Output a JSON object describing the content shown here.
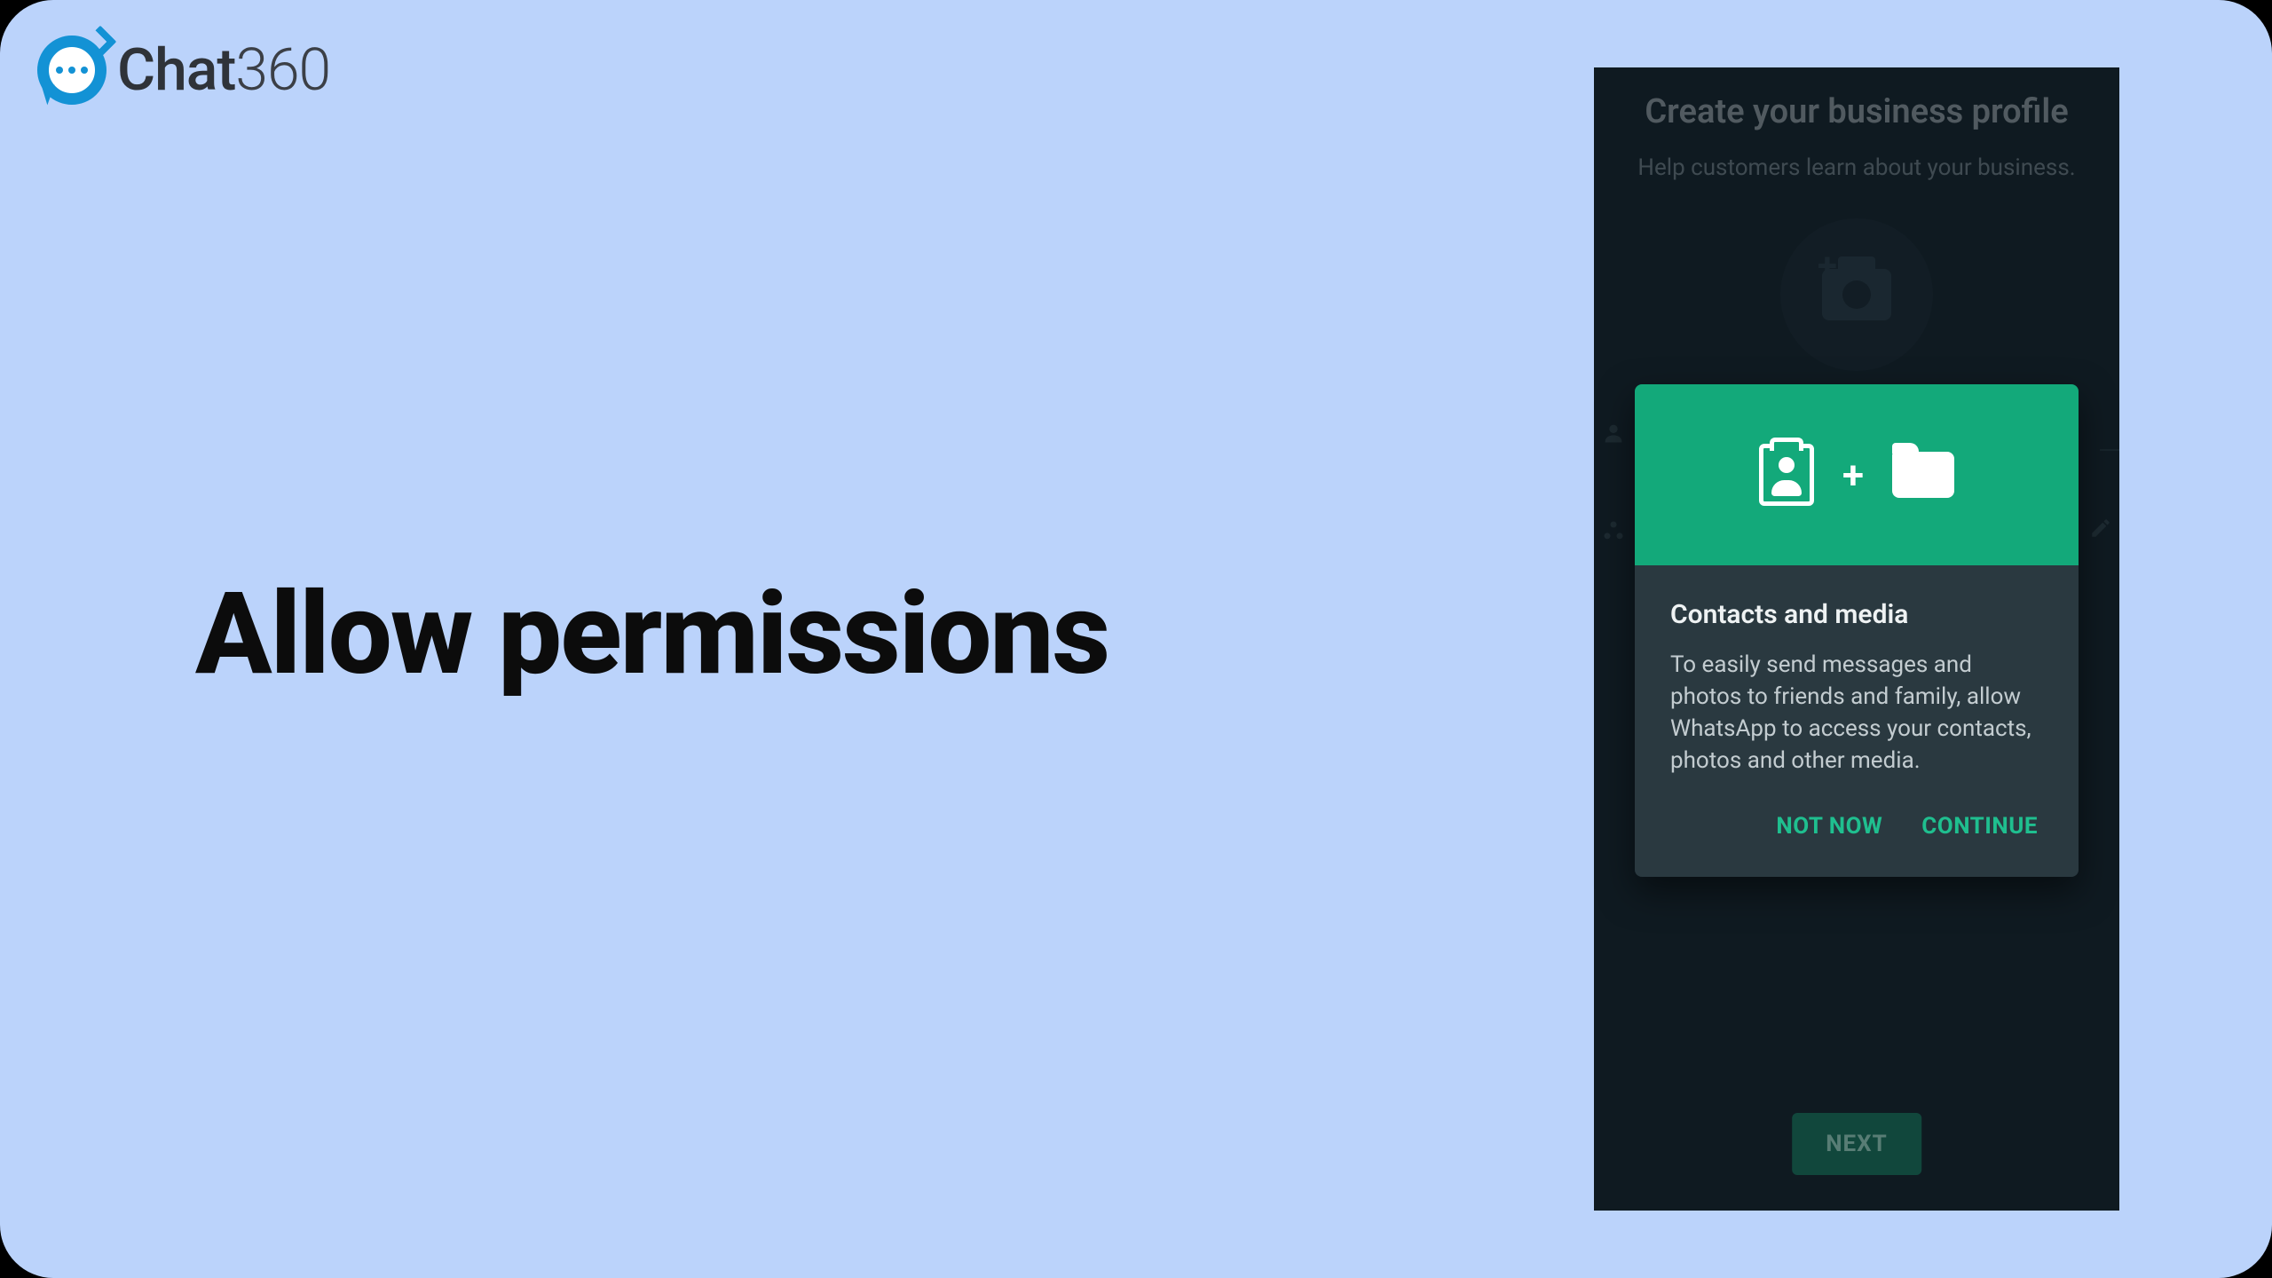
{
  "logo": {
    "brand_a": "Chat",
    "brand_b": "360"
  },
  "heading": "Allow permissions",
  "phone": {
    "profile_title": "Create your business profile",
    "profile_sub": "Help customers learn about your business.",
    "next_label": "NEXT"
  },
  "dialog": {
    "title": "Contacts and media",
    "body": "To easily send messages and photos to friends and family, allow WhatsApp to access your contacts, photos and other media.",
    "not_now": "NOT NOW",
    "continue": "CONTINUE"
  }
}
